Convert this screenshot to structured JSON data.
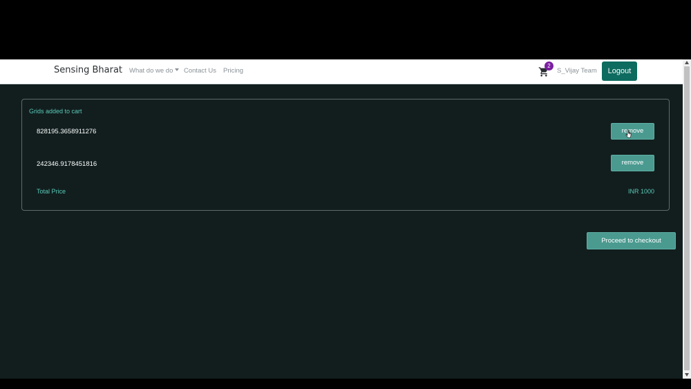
{
  "navbar": {
    "brand": "Sensing Bharat",
    "links": [
      "What do we do",
      "Contact Us",
      "Pricing"
    ],
    "cart_count": "2",
    "user": "S_Vijay Team",
    "logout_label": "Logout"
  },
  "cart": {
    "title": "Grids added to cart",
    "items": [
      {
        "value": "828195.3658911276",
        "remove_label": "remove"
      },
      {
        "value": "242346.9178451816",
        "remove_label": "remove"
      }
    ],
    "total_label": "Total Price",
    "total_value": "INR 1000"
  },
  "checkout_label": "Proceed to checkout",
  "colors": {
    "background": "#121e1e",
    "accent": "#4a9a90",
    "text_accent": "#59c9b9",
    "brand_button": "#0d6b5f",
    "badge": "#7b1fa2"
  },
  "icons": {
    "cart": "shopping-cart-icon",
    "cursor": "mouse-pointer-icon"
  }
}
